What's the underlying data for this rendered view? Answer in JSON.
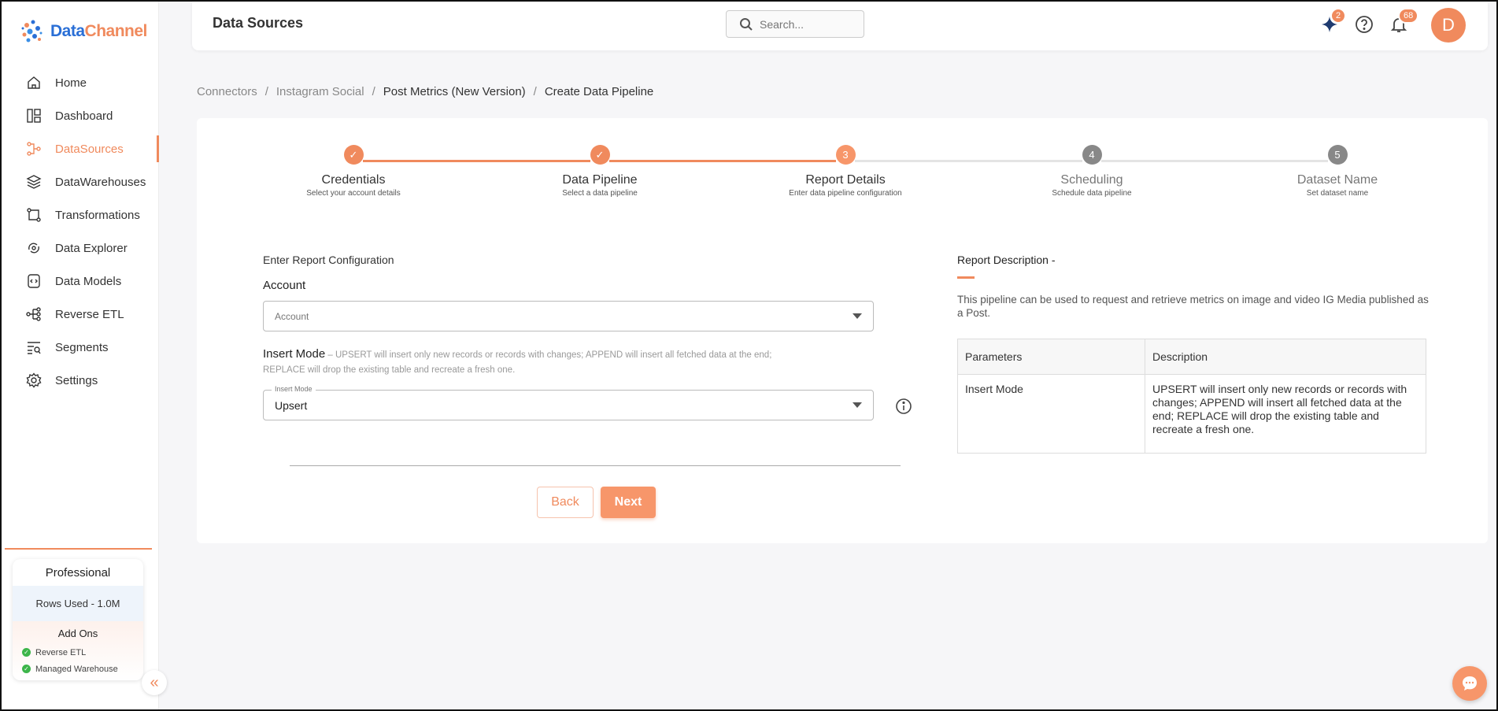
{
  "brand": {
    "name_part1": "Data",
    "name_part2": "Channel"
  },
  "sidebar": {
    "items": [
      {
        "label": "Home",
        "icon": "home-icon"
      },
      {
        "label": "Dashboard",
        "icon": "dashboard-icon"
      },
      {
        "label": "DataSources",
        "icon": "datasources-icon",
        "active": true
      },
      {
        "label": "DataWarehouses",
        "icon": "layers-icon"
      },
      {
        "label": "Transformations",
        "icon": "transform-icon"
      },
      {
        "label": "Data Explorer",
        "icon": "explorer-icon"
      },
      {
        "label": "Data Models",
        "icon": "models-icon"
      },
      {
        "label": "Reverse ETL",
        "icon": "reverse-etl-icon"
      },
      {
        "label": "Segments",
        "icon": "segments-icon"
      },
      {
        "label": "Settings",
        "icon": "gear-icon"
      }
    ],
    "plan": {
      "title": "Professional",
      "rows_used": "Rows Used - 1.0M",
      "addons_title": "Add Ons",
      "addons": [
        "Reverse ETL",
        "Managed Warehouse"
      ]
    }
  },
  "header": {
    "title": "Data Sources",
    "search_placeholder": "Search...",
    "sparkle_badge": "2",
    "notification_badge": "68",
    "avatar_initial": "D"
  },
  "breadcrumb": [
    "Connectors",
    "Instagram Social",
    "Post Metrics (New Version)",
    "Create Data Pipeline"
  ],
  "stepper": [
    {
      "marker": "✓",
      "title": "Credentials",
      "subtitle": "Select your account details",
      "state": "done"
    },
    {
      "marker": "✓",
      "title": "Data Pipeline",
      "subtitle": "Select a data pipeline",
      "state": "done"
    },
    {
      "marker": "3",
      "title": "Report Details",
      "subtitle": "Enter data pipeline configuration",
      "state": "current"
    },
    {
      "marker": "4",
      "title": "Scheduling",
      "subtitle": "Schedule data pipeline",
      "state": "pending"
    },
    {
      "marker": "5",
      "title": "Dataset Name",
      "subtitle": "Set dataset name",
      "state": "pending"
    }
  ],
  "form": {
    "heading": "Enter Report Configuration",
    "account_label": "Account",
    "account_placeholder": "Account",
    "insert_mode_label": "Insert Mode",
    "insert_mode_hint": " – UPSERT will insert only new records or records with changes; APPEND will insert all fetched data at the end; REPLACE will drop the existing table and recreate a fresh one.",
    "insert_mode_float_label": "Insert Mode",
    "insert_mode_value": "Upsert",
    "back_label": "Back",
    "next_label": "Next"
  },
  "report_description": {
    "title": "Report Description -",
    "text": "This pipeline can be used to request and retrieve metrics on image and video IG Media published as a Post.",
    "table": {
      "headers": [
        "Parameters",
        "Description"
      ],
      "rows": [
        [
          "Insert Mode",
          "UPSERT will insert only new records or records with changes; APPEND will insert all fetched data at the end; REPLACE will drop the existing table and recreate a fresh one."
        ]
      ]
    }
  },
  "colors": {
    "accent": "#f08a5d",
    "pending": "#888888",
    "brand_blue": "#2a6fd6"
  }
}
